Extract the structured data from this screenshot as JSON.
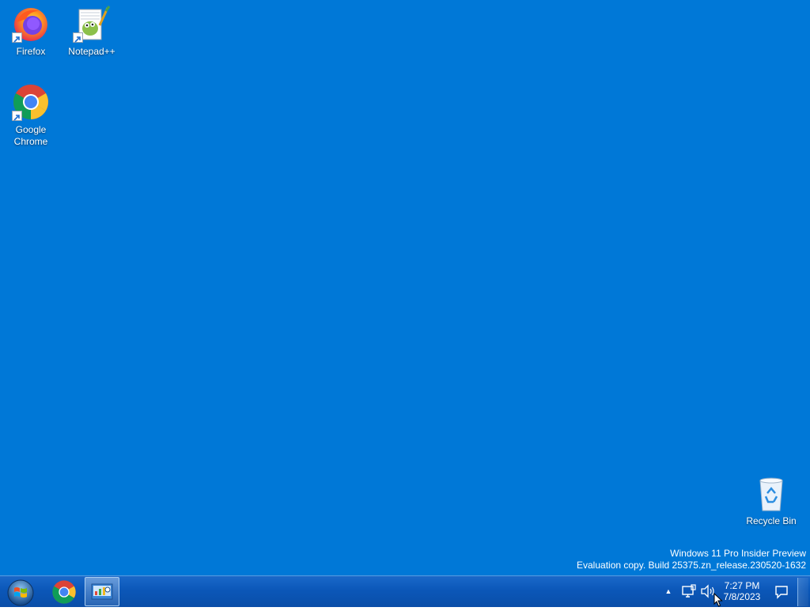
{
  "desktop": {
    "background_color": "#0078d7",
    "icons": [
      {
        "name": "firefox",
        "label": "Firefox",
        "icon": "firefox-icon"
      },
      {
        "name": "notepadpp",
        "label": "Notepad++",
        "icon": "notepadpp-icon"
      },
      {
        "name": "chrome",
        "label": "Google Chrome",
        "icon": "chrome-icon"
      },
      {
        "name": "recycle-bin",
        "label": "Recycle Bin",
        "icon": "recycle-bin-icon"
      }
    ],
    "watermark": {
      "line1": "Windows 11 Pro Insider Preview",
      "line2": "Evaluation copy. Build 25375.zn_release.230520-1632"
    }
  },
  "taskbar": {
    "start_icon": "windows-orb-icon",
    "pinned": [
      {
        "name": "chrome",
        "icon": "chrome-icon",
        "active": false
      },
      {
        "name": "control-panel",
        "icon": "control-panel-icon",
        "active": true
      }
    ],
    "tray": {
      "overflow_icon": "chevron-up-icon",
      "network_icon": "network-icon",
      "volume_icon": "volume-icon",
      "time": "7:27 PM",
      "date": "7/8/2023",
      "action_center_icon": "action-center-icon"
    }
  }
}
